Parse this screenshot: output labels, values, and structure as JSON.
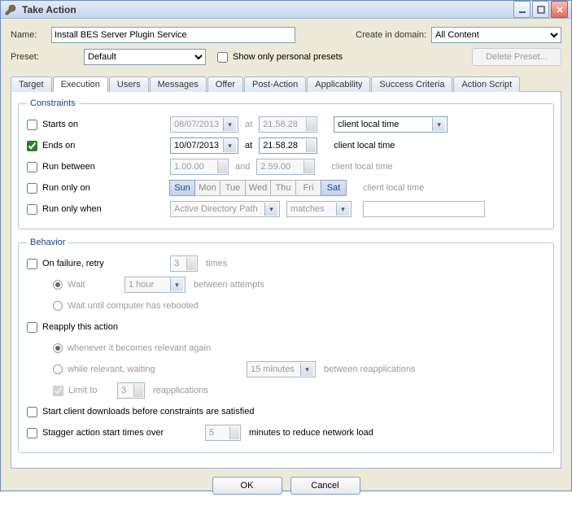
{
  "window": {
    "title": "Take Action"
  },
  "header": {
    "name_label": "Name:",
    "name_value": "Install BES Server Plugin Service",
    "domain_label": "Create in domain:",
    "domain_value": "All Content",
    "preset_label": "Preset:",
    "preset_value": "Default",
    "show_personal": "Show only personal presets",
    "delete_preset": "Delete Preset..."
  },
  "tabs": [
    "Target",
    "Execution",
    "Users",
    "Messages",
    "Offer",
    "Post-Action",
    "Applicability",
    "Success Criteria",
    "Action Script"
  ],
  "constraints": {
    "legend": "Constraints",
    "starts_on": "Starts on",
    "starts_date": "08/07/2013",
    "at": "at",
    "starts_time": "21.58.28",
    "starts_tz": "client local time",
    "ends_on": "Ends on",
    "ends_date": "10/07/2013",
    "ends_time": "21.58.28",
    "ends_tz": "client local time",
    "run_between": "Run between",
    "rb_from": "1.00.00",
    "and": "and",
    "rb_to": "2.59.00",
    "rb_tz": "client local time",
    "run_only_on": "Run only on",
    "days": [
      "Sun",
      "Mon",
      "Tue",
      "Wed",
      "Thu",
      "Fri",
      "Sat"
    ],
    "days_tz": "client local time",
    "run_only_when": "Run only when",
    "row_source": "Active Directory Path",
    "row_op": "matches"
  },
  "behavior": {
    "legend": "Behavior",
    "on_failure": "On failure, retry",
    "retry_n": "3",
    "times": "times",
    "wait": "Wait",
    "wait_val": "1 hour",
    "between_attempts": "between attempts",
    "wait_reboot": "Wait until computer has rebooted",
    "reapply": "Reapply this action",
    "whenever": "whenever it becomes relevant again",
    "while_relevant": "while relevant, waiting",
    "while_val": "15 minutes",
    "between_reapp": "between reapplications",
    "limit_to": "Limit to",
    "limit_n": "3",
    "reapplications": "reapplications",
    "start_downloads": "Start client downloads before constraints are satisfied",
    "stagger": "Stagger action start times over",
    "stagger_n": "5",
    "stagger_tail": "minutes to reduce network load"
  },
  "buttons": {
    "ok": "OK",
    "cancel": "Cancel"
  }
}
